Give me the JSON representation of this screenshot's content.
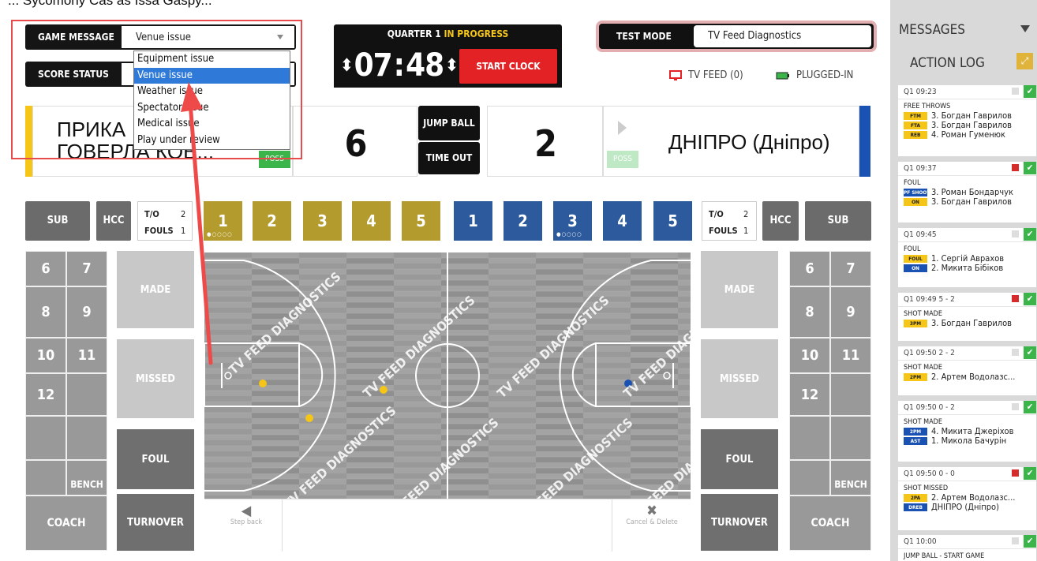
{
  "top_strip": "... Sycomony Cas as Issa Gaspy...",
  "game_message": {
    "label": "GAME MESSAGE",
    "value": "Venue issue"
  },
  "score_status": {
    "label": "SCORE STATUS"
  },
  "dropdown_options": [
    "Equipment issue",
    "Venue issue",
    "Weather issue",
    "Spectator issue",
    "Medical issue",
    "Play under review"
  ],
  "clock": {
    "quarter": "QUARTER 1",
    "state": "IN PROGRESS",
    "minutes": "07",
    "seconds": "48",
    "start_label": "START CLOCK"
  },
  "test_mode": {
    "label": "TEST MODE",
    "value": "TV Feed Diagnostics"
  },
  "status": {
    "tv_feed": "TV FEED (0)",
    "plugged": "PLUGGED-IN"
  },
  "home": {
    "name_line1": "ПРИКА",
    "name_line2": "ГОВЕРЛА КОВ...",
    "score": "6",
    "poss": "POSS",
    "color": "#f5c518"
  },
  "away": {
    "name": "ДНІПРО (Дніпро)",
    "score": "2",
    "poss": "POSS",
    "color": "#1a52b3"
  },
  "center_buttons": {
    "jump_ball": "JUMP BALL",
    "time_out": "TIME OUT"
  },
  "row": {
    "sub": "SUB",
    "hcc": "HCC",
    "to_label": "T/O",
    "fouls_label": "FOULS",
    "home_to": "2",
    "home_fouls": "1",
    "away_to": "2",
    "away_fouls": "1",
    "home_players": [
      "1",
      "2",
      "3",
      "4",
      "5"
    ],
    "away_players": [
      "1",
      "2",
      "3",
      "4",
      "5"
    ],
    "dots": "●○○○○"
  },
  "left_grid": {
    "numbers": [
      "6",
      "7",
      "8",
      "9",
      "10",
      "11",
      "12"
    ],
    "bench": "BENCH",
    "coach": "COACH"
  },
  "right_grid": {
    "numbers": [
      "6",
      "7",
      "8",
      "9",
      "10",
      "11",
      "12"
    ],
    "bench": "BENCH",
    "coach": "COACH"
  },
  "actions": {
    "made": "MADE",
    "missed": "MISSED",
    "foul": "FOUL",
    "turnover": "TURNOVER"
  },
  "court": {
    "watermark": "TV FEED DIAGNOSTICS",
    "step_back": "Step back",
    "cancel_delete": "Cancel & Delete"
  },
  "panel": {
    "messages": "MESSAGES",
    "action_log": "ACTION LOG",
    "entries": [
      {
        "head": "Q1  09:23",
        "type": "FREE THROWS",
        "flag": false,
        "lines": [
          {
            "tag": "FTM",
            "c": "y",
            "text": "3. Богдан Гаврилов"
          },
          {
            "tag": "FTA",
            "c": "y",
            "text": "3. Богдан Гаврилов"
          },
          {
            "tag": "REB",
            "c": "y",
            "text": "4. Роман Гуменюк"
          }
        ]
      },
      {
        "head": "Q1  09:37",
        "type": "FOUL",
        "flag": true,
        "lines": [
          {
            "tag": "PF SHOOT",
            "c": "b",
            "text": "3. Роман Бондарчук"
          },
          {
            "tag": "ON",
            "c": "y",
            "text": "3. Богдан Гаврилов"
          }
        ]
      },
      {
        "head": "Q1  09:45",
        "type": "FOUL",
        "flag": false,
        "lines": [
          {
            "tag": "FOUL",
            "c": "y",
            "text": "1. Сергій Аврахов"
          },
          {
            "tag": "ON",
            "c": "b",
            "text": "2. Микита Бібіков"
          }
        ]
      },
      {
        "head": "Q1  09:49   5 - 2",
        "type": "SHOT MADE",
        "flag": true,
        "lines": [
          {
            "tag": "3PM",
            "c": "y",
            "text": "3. Богдан Гаврилов"
          }
        ]
      },
      {
        "head": "Q1  09:50   2 - 2",
        "type": "SHOT MADE",
        "flag": false,
        "lines": [
          {
            "tag": "2PM",
            "c": "y",
            "text": "2. Артем Водолазс..."
          }
        ]
      },
      {
        "head": "Q1  09:50   0 - 2",
        "type": "SHOT MADE",
        "flag": false,
        "lines": [
          {
            "tag": "2PM",
            "c": "b",
            "text": "4. Микита Джеріхов"
          },
          {
            "tag": "AST",
            "c": "b",
            "text": "1. Микола Бачурін"
          }
        ]
      },
      {
        "head": "Q1  09:50   0 - 0",
        "type": "SHOT MISSED",
        "flag": true,
        "lines": [
          {
            "tag": "2PA",
            "c": "y",
            "text": "2. Артем Водолазс..."
          },
          {
            "tag": "DREB",
            "c": "b",
            "text": "ДНІПРО (Дніпро)"
          }
        ]
      },
      {
        "head": "Q1  10:00",
        "type": "JUMP BALL - START GAME",
        "flag": false,
        "lines": []
      }
    ]
  }
}
